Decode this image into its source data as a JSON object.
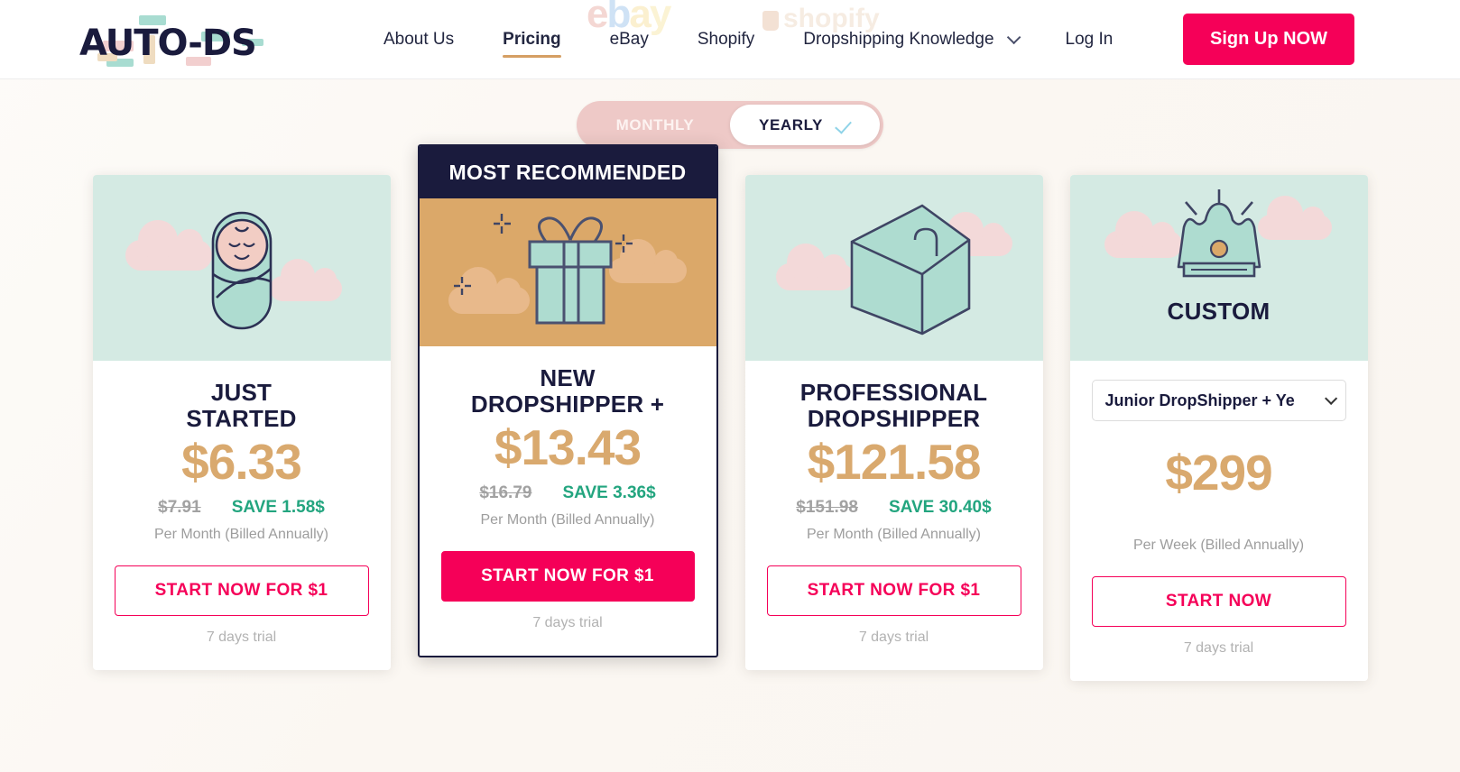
{
  "header": {
    "logo_text": "AUTO-DS",
    "nav": [
      {
        "label": "About Us",
        "active": false,
        "dropdown": false
      },
      {
        "label": "Pricing",
        "active": true,
        "dropdown": false
      },
      {
        "label": "eBay",
        "active": false,
        "dropdown": false
      },
      {
        "label": "Shopify",
        "active": false,
        "dropdown": false
      },
      {
        "label": "Dropshipping Knowledge",
        "active": false,
        "dropdown": true
      },
      {
        "label": "Log In",
        "active": false,
        "dropdown": false
      }
    ],
    "signup_label": "Sign Up NOW",
    "watermark_ebay": "ebay",
    "watermark_shopify": "shopify",
    "accent_pink": "#F50058",
    "accent_gold": "#D59F63"
  },
  "billing_toggle": {
    "monthly_label": "MONTHLY",
    "yearly_label": "YEARLY",
    "selected": "YEARLY"
  },
  "plans": [
    {
      "icon": "baby-icon",
      "name": "JUST\nSTARTED",
      "price": "$6.33",
      "old_price": "$7.91",
      "save": "SAVE 1.58$",
      "billed": "Per Month (Billed Annually)",
      "cta": "START NOW FOR $1",
      "trial": "7 days trial",
      "ribbon": "",
      "featured": false
    },
    {
      "icon": "gift-icon",
      "name": "NEW\nDROPSHIPPER +",
      "price": "$13.43",
      "old_price": "$16.79",
      "save": "SAVE 3.36$",
      "billed": "Per Month (Billed Annually)",
      "cta": "START NOW FOR $1",
      "trial": "7 days trial",
      "ribbon": "MOST RECOMMENDED",
      "featured": true
    },
    {
      "icon": "briefcase-icon",
      "name": "PROFESSIONAL\nDROPSHIPPER",
      "price": "$121.58",
      "old_price": "$151.98",
      "save": "SAVE 30.40$",
      "billed": "Per Month (Billed Annually)",
      "cta": "START NOW FOR $1",
      "trial": "7 days trial",
      "ribbon": "",
      "featured": false
    },
    {
      "icon": "crown-icon",
      "name": "CUSTOM",
      "select_value": "Junior DropShipper + Ye",
      "price": "$299",
      "old_price": "",
      "save": "",
      "billed": "Per Week (Billed Annually)",
      "cta": "START NOW",
      "trial": "7 days trial",
      "ribbon": "",
      "featured": false
    }
  ]
}
